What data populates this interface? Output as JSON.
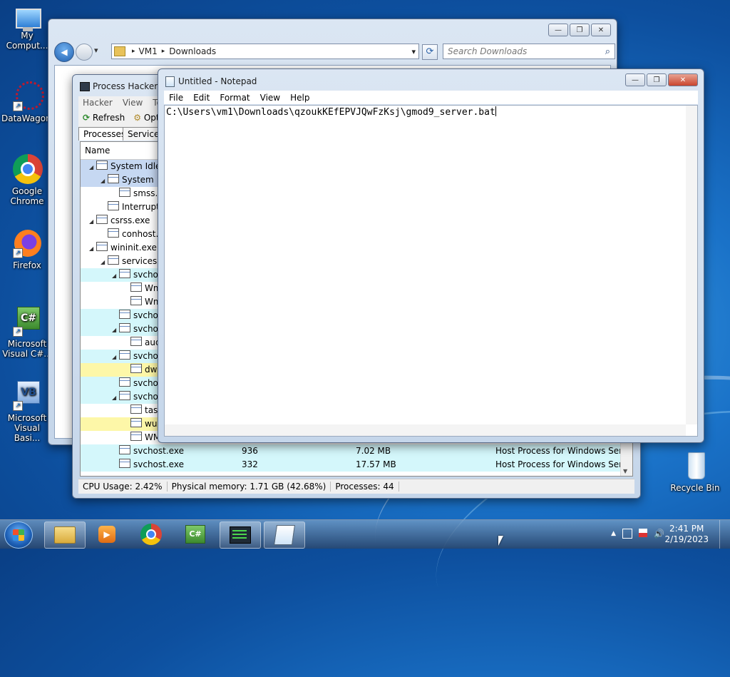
{
  "desktop": {
    "icons": [
      {
        "label": "My Comput..."
      },
      {
        "label": "DataWagon..."
      },
      {
        "label": "Google Chrome"
      },
      {
        "label": "Firefox"
      },
      {
        "label": "Microsoft Visual C#..."
      },
      {
        "label": "Microsoft Visual Basi..."
      },
      {
        "label": "Recycle Bin"
      }
    ]
  },
  "explorer": {
    "breadcrumb": [
      "VM1",
      "Downloads"
    ],
    "search_placeholder": "Search Downloads",
    "sep": "▸",
    "dropdown_glyph": "▾",
    "refresh_glyph": "⟳",
    "search_glyph": "⌕",
    "back_glyph": "◀"
  },
  "process_hacker": {
    "title": "Process Hacker [C",
    "menu": [
      "Hacker",
      "View",
      "To"
    ],
    "toolbar": {
      "refresh": "Refresh",
      "options": "Opt"
    },
    "tabs": [
      "Processes",
      "Services"
    ],
    "column_name": "Name",
    "rows": [
      {
        "indent": 0,
        "expander": "◢",
        "name": "System Idle P",
        "pid": "",
        "mem": "",
        "desc": "",
        "bg": "#c6d8f2"
      },
      {
        "indent": 1,
        "expander": "◢",
        "name": "System",
        "pid": "",
        "mem": "",
        "desc": "",
        "bg": "#c6d8f2"
      },
      {
        "indent": 2,
        "expander": "",
        "name": "smss.e",
        "pid": "",
        "mem": "",
        "desc": "",
        "bg": "#ffffff"
      },
      {
        "indent": 1,
        "expander": "",
        "name": "Interrupts",
        "pid": "",
        "mem": "",
        "desc": "",
        "bg": "#ffffff"
      },
      {
        "indent": 0,
        "expander": "◢",
        "name": "csrss.exe",
        "pid": "",
        "mem": "",
        "desc": "",
        "bg": "#ffffff"
      },
      {
        "indent": 1,
        "expander": "",
        "name": "conhost.e",
        "pid": "",
        "mem": "",
        "desc": "",
        "bg": "#ffffff"
      },
      {
        "indent": 0,
        "expander": "◢",
        "name": "wininit.exe",
        "pid": "",
        "mem": "",
        "desc": "",
        "bg": "#ffffff"
      },
      {
        "indent": 1,
        "expander": "◢",
        "name": "services.e",
        "pid": "",
        "mem": "",
        "desc": "",
        "bg": "#ffffff"
      },
      {
        "indent": 2,
        "expander": "◢",
        "name": "svchos",
        "pid": "",
        "mem": "",
        "desc": "",
        "bg": "#d4f7fb"
      },
      {
        "indent": 3,
        "expander": "",
        "name": "Wm",
        "pid": "",
        "mem": "",
        "desc": "",
        "bg": "#ffffff"
      },
      {
        "indent": 3,
        "expander": "",
        "name": "Wm",
        "pid": "",
        "mem": "",
        "desc": "",
        "bg": "#ffffff"
      },
      {
        "indent": 2,
        "expander": "",
        "name": "svchos",
        "pid": "",
        "mem": "",
        "desc": "",
        "bg": "#d4f7fb"
      },
      {
        "indent": 2,
        "expander": "◢",
        "name": "svchos",
        "pid": "",
        "mem": "",
        "desc": "",
        "bg": "#d4f7fb"
      },
      {
        "indent": 3,
        "expander": "",
        "name": "aud",
        "pid": "",
        "mem": "",
        "desc": "",
        "bg": "#ffffff"
      },
      {
        "indent": 2,
        "expander": "◢",
        "name": "svchos",
        "pid": "",
        "mem": "",
        "desc": "",
        "bg": "#d4f7fb"
      },
      {
        "indent": 3,
        "expander": "",
        "name": "dwi",
        "pid": "",
        "mem": "",
        "desc": "",
        "bg": "#fdf7a8"
      },
      {
        "indent": 2,
        "expander": "",
        "name": "svchos",
        "pid": "",
        "mem": "",
        "desc": "",
        "bg": "#d4f7fb"
      },
      {
        "indent": 2,
        "expander": "◢",
        "name": "svchos",
        "pid": "",
        "mem": "",
        "desc": "",
        "bg": "#d4f7fb"
      },
      {
        "indent": 3,
        "expander": "",
        "name": "task",
        "pid": "",
        "mem": "",
        "desc": "",
        "bg": "#ffffff"
      },
      {
        "indent": 3,
        "expander": "",
        "name": "wu",
        "pid": "",
        "mem": "",
        "desc": "",
        "bg": "#fdf7a8"
      },
      {
        "indent": 3,
        "expander": "",
        "name": "WM",
        "pid": "",
        "mem": "",
        "desc": "",
        "bg": "#ffffff"
      },
      {
        "indent": 2,
        "expander": "",
        "name": "svchost.exe",
        "pid": "936",
        "mem": "7.02 MB",
        "desc": "Host Process for Windows Ser...",
        "bg": "#d4f7fb"
      },
      {
        "indent": 2,
        "expander": "",
        "name": "svchost.exe",
        "pid": "332",
        "mem": "17.57 MB",
        "desc": "Host Process for Windows Ser...",
        "bg": "#d4f7fb"
      }
    ],
    "status": {
      "cpu": "CPU Usage: 2.42%",
      "memory": "Physical memory: 1.71 GB (42.68%)",
      "processes": "Processes: 44"
    }
  },
  "notepad": {
    "title": "Untitled - Notepad",
    "menu": [
      "File",
      "Edit",
      "Format",
      "View",
      "Help"
    ],
    "content": "C:\\Users\\vm1\\Downloads\\qzoukKEfEPVJQwFzKsj\\gmod9_server.bat",
    "buttons": {
      "min": "—",
      "max": "❐",
      "close": "✕"
    }
  },
  "explorer_buttons": {
    "min": "—",
    "max": "❐",
    "close": "✕"
  },
  "taskbar": {
    "items": [
      "explorer",
      "media-player",
      "chrome",
      "visual-csharp",
      "process-hacker",
      "notepad"
    ],
    "clock_time": "2:41 PM",
    "clock_date": "2/19/2023",
    "tray_up": "▲",
    "tray_volume": "🔊"
  }
}
